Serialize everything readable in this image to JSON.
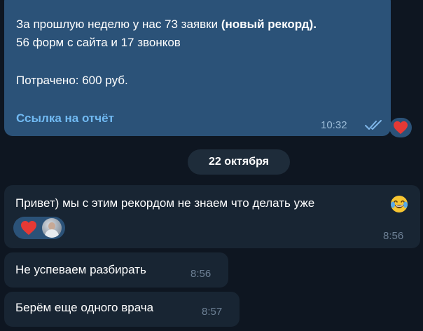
{
  "outgoing_message": {
    "line1_prefix": "За прошлую неделю у нас 73 заявки",
    "line1_bold": "(новый рекорд).",
    "line2": "56 форм с сайта и 17 звонков",
    "line3": "Потрачено: 600 руб.",
    "link_text": "Ссылка на отчёт",
    "time": "10:32",
    "status_icon": "double-check-icon",
    "reaction_icon": "heart-icon"
  },
  "date_separator": "22 октября",
  "incoming_messages": [
    {
      "text": "Привет) мы с этим рекордом не знаем что делать уже",
      "emoji_icon": "face-with-tears-of-joy-icon",
      "reactions": [
        "heart-icon",
        "avatar"
      ],
      "time": "8:56"
    },
    {
      "text": "Не успеваем разбирать",
      "time": "8:56"
    },
    {
      "text": "Берём еще одного врача",
      "time": "8:57"
    }
  ],
  "colors": {
    "background": "#0e1621",
    "outgoing_bubble": "#2b5278",
    "incoming_bubble": "#182533",
    "link": "#71baf3",
    "heart": "#e53935"
  }
}
